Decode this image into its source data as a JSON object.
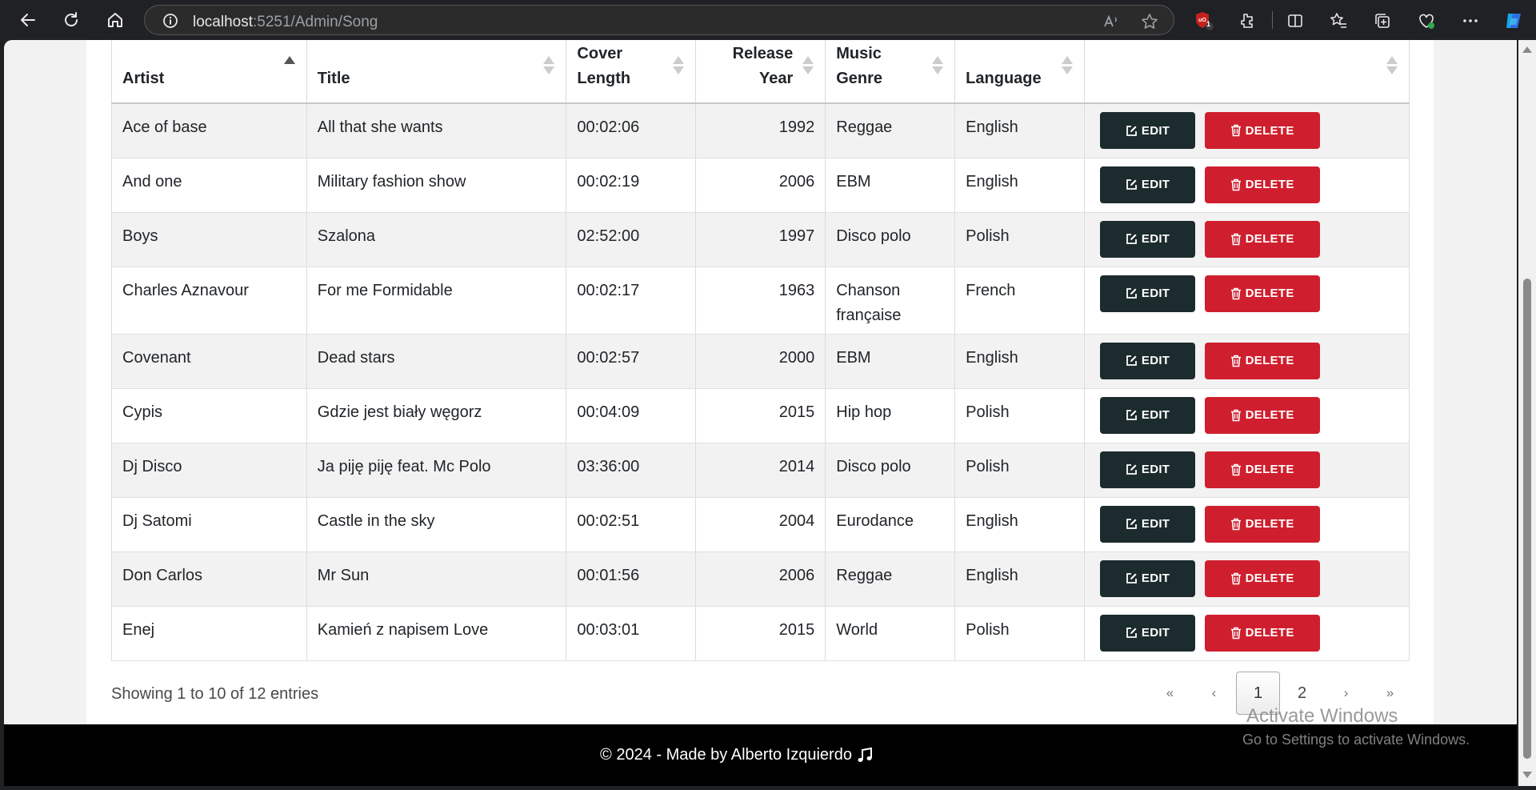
{
  "browser": {
    "url_host": "localhost",
    "url_path": ":5251/Admin/Song",
    "extension_badge": "1",
    "colors": {
      "chrome_bg": "#202124",
      "badge": "#c5221f"
    }
  },
  "table": {
    "headers": {
      "artist": "Artist",
      "title": "Title",
      "cover_length_1": "Cover",
      "cover_length_2": "Length",
      "release_year_1": "Release",
      "release_year_2": "Year",
      "music_genre_1": "Music",
      "music_genre_2": "Genre",
      "language": "Language"
    },
    "sorted_column": "Artist",
    "sort_direction": "ascending",
    "rows": [
      {
        "artist": "Ace of base",
        "title": "All that she wants",
        "cover_length": "00:02:06",
        "release_year": "1992",
        "music_genre": "Reggae",
        "language": "English"
      },
      {
        "artist": "And one",
        "title": "Military fashion show",
        "cover_length": "00:02:19",
        "release_year": "2006",
        "music_genre": "EBM",
        "language": "English"
      },
      {
        "artist": "Boys",
        "title": "Szalona",
        "cover_length": "02:52:00",
        "release_year": "1997",
        "music_genre": "Disco polo",
        "language": "Polish"
      },
      {
        "artist": "Charles Aznavour",
        "title": "For me Formidable",
        "cover_length": "00:02:17",
        "release_year": "1963",
        "music_genre": "Chanson française",
        "language": "French"
      },
      {
        "artist": "Covenant",
        "title": "Dead stars",
        "cover_length": "00:02:57",
        "release_year": "2000",
        "music_genre": "EBM",
        "language": "English"
      },
      {
        "artist": "Cypis",
        "title": "Gdzie jest biały węgorz",
        "cover_length": "00:04:09",
        "release_year": "2015",
        "music_genre": "Hip hop",
        "language": "Polish"
      },
      {
        "artist": "Dj Disco",
        "title": "Ja piję piję feat. Mc Polo",
        "cover_length": "03:36:00",
        "release_year": "2014",
        "music_genre": "Disco polo",
        "language": "Polish"
      },
      {
        "artist": "Dj Satomi",
        "title": "Castle in the sky",
        "cover_length": "00:02:51",
        "release_year": "2004",
        "music_genre": "Eurodance",
        "language": "English"
      },
      {
        "artist": "Don Carlos",
        "title": "Mr Sun",
        "cover_length": "00:01:56",
        "release_year": "2006",
        "music_genre": "Reggae",
        "language": "English"
      },
      {
        "artist": "Enej",
        "title": "Kamień z napisem Love",
        "cover_length": "00:03:01",
        "release_year": "2015",
        "music_genre": "World",
        "language": "Polish"
      }
    ],
    "edit_label": "EDIT",
    "delete_label": "DELETE",
    "colors": {
      "edit_bg": "#1c2b2d",
      "delete_bg": "#cf1f2e",
      "stripe": "#f2f2f2"
    }
  },
  "pagination": {
    "info": "Showing 1 to 10 of 12 entries",
    "first": "«",
    "previous": "‹",
    "pages": [
      "1",
      "2"
    ],
    "current_page": "1",
    "next": "›",
    "last": "»"
  },
  "watermark": {
    "line1": "Activate Windows",
    "line2": "Go to Settings to activate Windows."
  },
  "footer": {
    "text": "© 2024 - Made by Alberto Izquierdo",
    "icon": "music-note-icon"
  }
}
